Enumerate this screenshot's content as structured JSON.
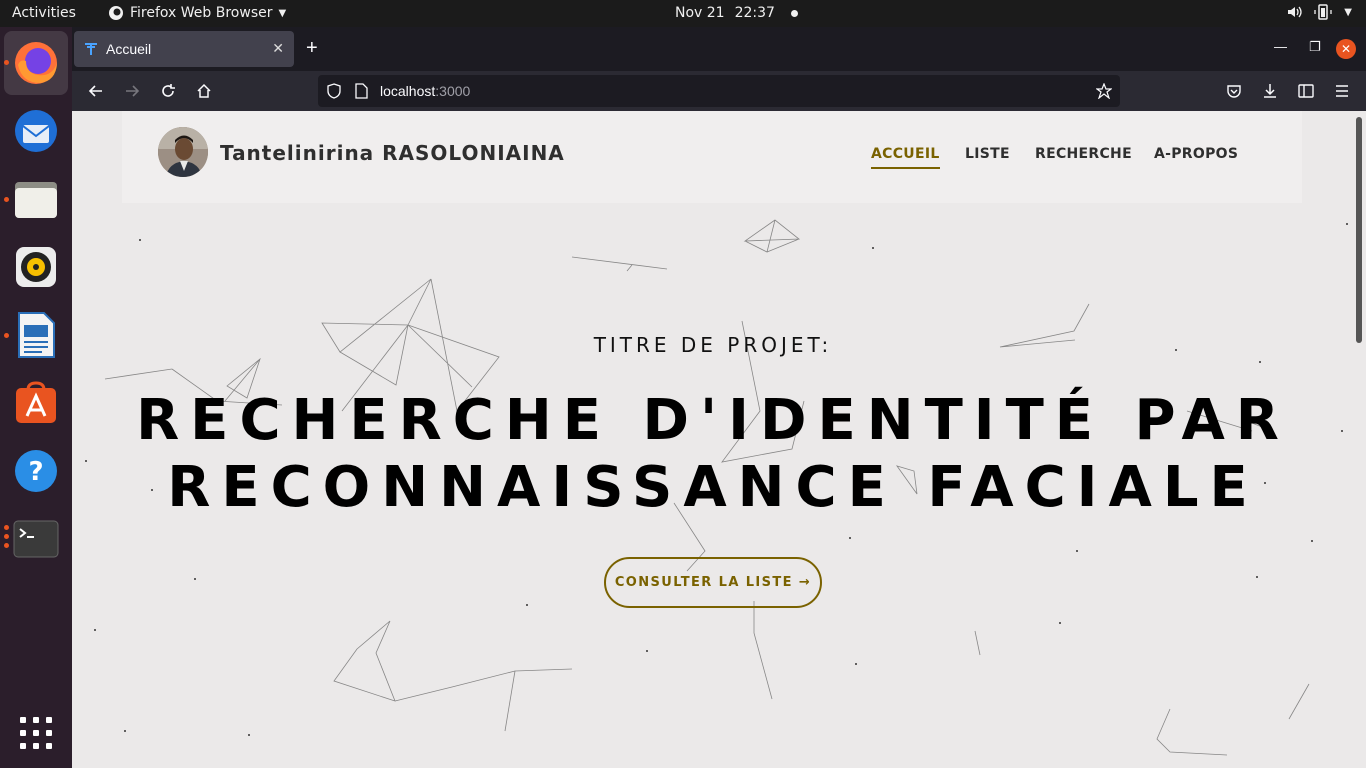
{
  "topbar": {
    "activities": "Activities",
    "app_name": "Firefox Web Browser",
    "date": "Nov 21",
    "time": "22:37"
  },
  "dock": {
    "items": [
      "firefox",
      "thunderbird",
      "files",
      "rhythmbox",
      "libreoffice-writer",
      "ubuntu-software",
      "help",
      "terminal",
      "show-applications"
    ]
  },
  "browser": {
    "tab_title": "Accueil",
    "url_host": "localhost",
    "url_port": ":3000"
  },
  "site": {
    "author": "Tantelinirina RASOLONIAINA",
    "nav": [
      "ACCUEIL",
      "LISTE",
      "RECHERCHE",
      "A-PROPOS"
    ],
    "active_nav": "ACCUEIL",
    "subtitle": "TITRE DE PROJET:",
    "title_line1": "RECHERCHE D'IDENTITÉ PAR",
    "title_line2": "RECONNAISSANCE FACIALE",
    "cta": "CONSULTER LA LISTE →"
  },
  "colors": {
    "accent": "#7a6200",
    "page_bg": "#ebe9e9",
    "dock_bg": "#2b1e2b",
    "close_button": "#e95420"
  }
}
